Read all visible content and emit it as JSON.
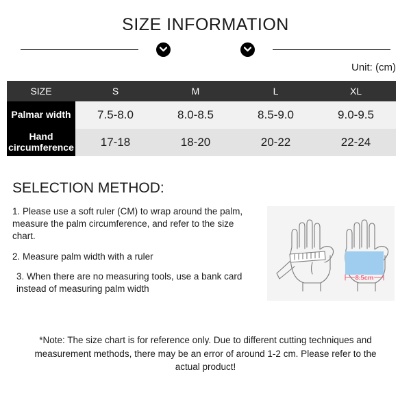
{
  "header": {
    "title": "SIZE INFORMATION",
    "badge_icon": "chevron-down-icon",
    "unit_label": "Unit: (cm)"
  },
  "table": {
    "corner_label": "SIZE",
    "sizes": [
      "S",
      "M",
      "L",
      "XL"
    ],
    "rows": [
      {
        "label": "Palmar width",
        "values": [
          "7.5-8.0",
          "8.0-8.5",
          "8.5-9.0",
          "9.0-9.5"
        ]
      },
      {
        "label": "Hand circumference",
        "values": [
          "17-18",
          "18-20",
          "20-22",
          "22-24"
        ]
      }
    ]
  },
  "selection": {
    "title": "SELECTION METHOD:",
    "steps": [
      "1. Please use a soft ruler (CM) to wrap around the palm, measure the palm circumference, and refer to the size chart.",
      "2. Measure palm width with a ruler",
      "3. When there are no measuring tools, use a bank card instead of measuring palm width"
    ]
  },
  "illustration": {
    "left_figure": "hand-with-ruler-icon",
    "right_figure": "hand-with-card-icon",
    "card_measure_label": "8.5cm",
    "card_color": "#9ecdf0",
    "measure_label_color": "#f4607a",
    "outline_color": "#7a7a7a",
    "panel_color": "#f4f4f4"
  },
  "footer": {
    "note": "*Note: The size chart is for reference only. Due to different cutting techniques and measurement methods, there may be an error of around 1-2 cm. Please refer to the actual product!"
  }
}
